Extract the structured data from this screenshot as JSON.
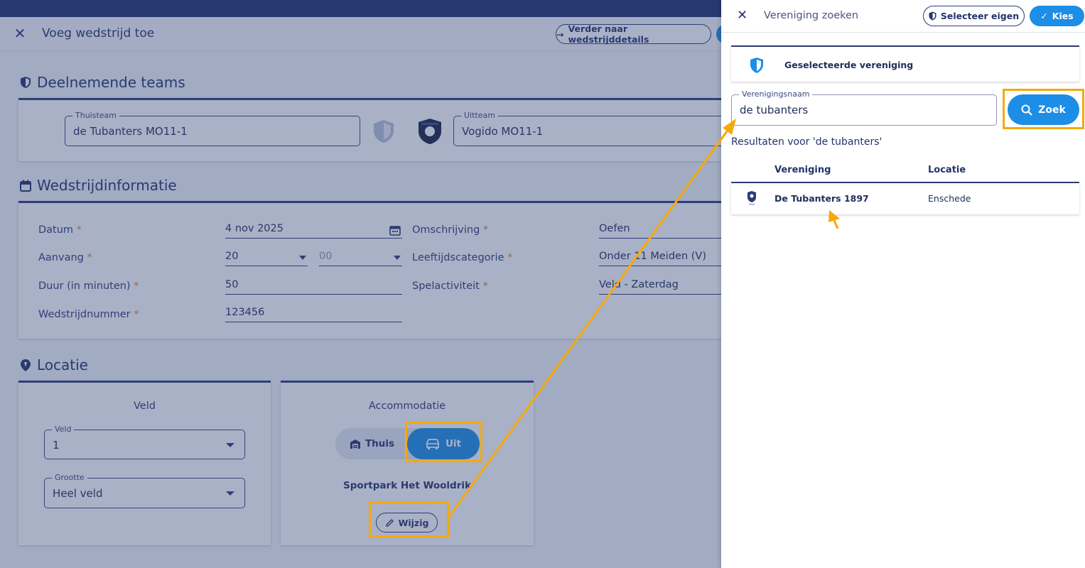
{
  "header": {
    "close_icon": "close-icon",
    "title": "Voeg wedstrijd toe",
    "next_button": "Verder naar wedstrijddetails"
  },
  "teams": {
    "section_title": "Deelnemende teams",
    "home_label": "Thuisteam",
    "home_value": "de Tubanters MO11-1",
    "away_label": "Uitteam",
    "away_value": "Vogido MO11-1"
  },
  "info": {
    "section_title": "Wedstrijdinformatie",
    "date_label": "Datum",
    "date_value": "4 nov 2025",
    "start_label": "Aanvang",
    "start_hour": "20",
    "start_minute": "00",
    "duration_label": "Duur (in minuten)",
    "duration_value": "50",
    "number_label": "Wedstrijdnummer",
    "number_value": "123456",
    "desc_label": "Omschrijving",
    "desc_value": "Oefen",
    "age_label": "Leeftijdscategorie",
    "age_value": "Onder 11 Meiden (V)",
    "activity_label": "Spelactiviteit",
    "activity_value": "Veld - Zaterdag",
    "required_mark": "*"
  },
  "location": {
    "section_title": "Locatie",
    "field_card_title": "Veld",
    "field_label": "Veld",
    "field_value": "1",
    "size_label": "Grootte",
    "size_value": "Heel veld",
    "accom_card_title": "Accommodatie",
    "toggle_home": "Thuis",
    "toggle_away": "Uit",
    "venue": "Sportpark Het Wooldrik",
    "change_button": "Wijzig"
  },
  "panel": {
    "title": "Vereniging zoeken",
    "select_own": "Selecteer eigen",
    "choose": "Kies",
    "selected_club": "Geselecteerde vereniging",
    "search_label": "Verenigingsnaam",
    "search_value": "de tubanters",
    "search_button": "Zoek",
    "results_title": "Resultaten voor 'de tubanters'",
    "col_club": "Vereniging",
    "col_location": "Locatie",
    "results": [
      {
        "club": "De Tubanters 1897",
        "location": "Enschede"
      }
    ]
  },
  "colors": {
    "brand": "#24336b",
    "accent": "#1c8ee6",
    "highlight": "#f5a90c",
    "required": "#e08a1e"
  }
}
